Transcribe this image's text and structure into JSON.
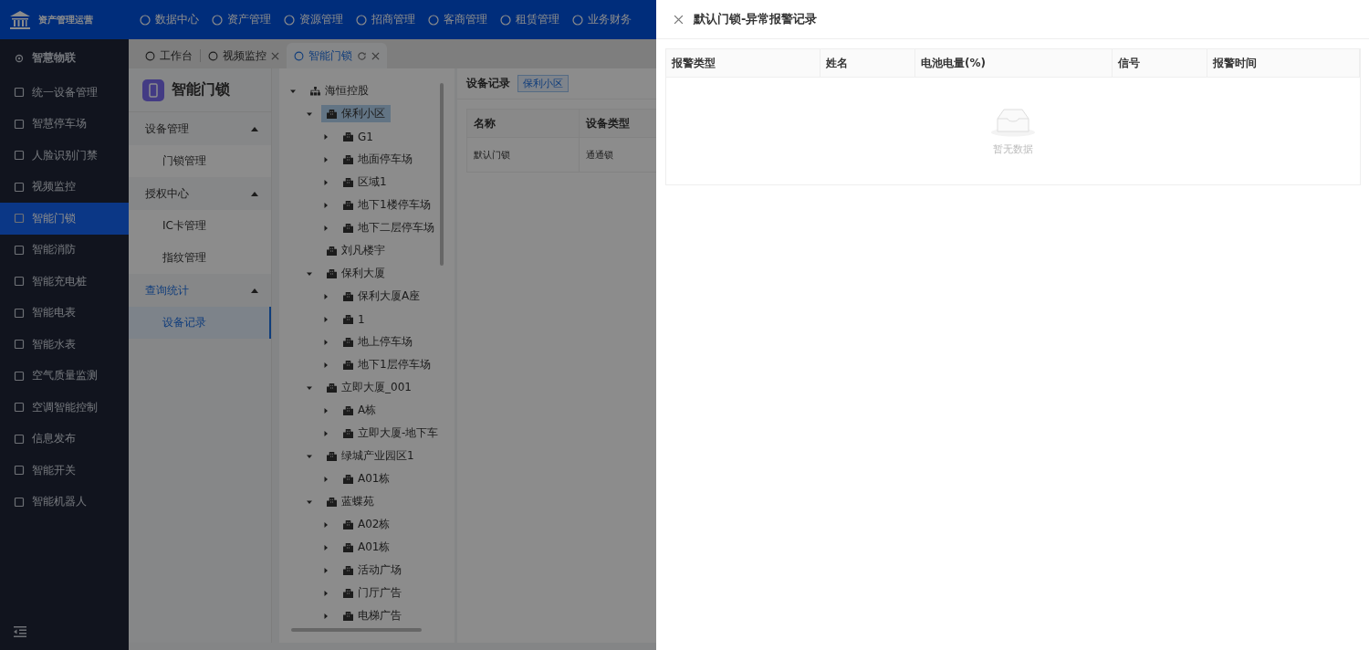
{
  "header": {
    "app_title": "资产管理运营",
    "nav": [
      {
        "label": "数据中心"
      },
      {
        "label": "资产管理"
      },
      {
        "label": "资源管理"
      },
      {
        "label": "招商管理"
      },
      {
        "label": "客商管理"
      },
      {
        "label": "租赁管理"
      },
      {
        "label": "业务财务"
      }
    ]
  },
  "sidebar": {
    "section": "智慧物联",
    "items": [
      {
        "label": "统一设备管理",
        "selected": false
      },
      {
        "label": "智慧停车场",
        "selected": false
      },
      {
        "label": "人脸识别门禁",
        "selected": false
      },
      {
        "label": "视频监控",
        "selected": false
      },
      {
        "label": "智能门锁",
        "selected": true
      },
      {
        "label": "智能消防",
        "selected": false
      },
      {
        "label": "智能充电桩",
        "selected": false
      },
      {
        "label": "智能电表",
        "selected": false
      },
      {
        "label": "智能水表",
        "selected": false
      },
      {
        "label": "空气质量监测",
        "selected": false
      },
      {
        "label": "空调智能控制",
        "selected": false
      },
      {
        "label": "信息发布",
        "selected": false
      },
      {
        "label": "智能开关",
        "selected": false
      },
      {
        "label": "智能机器人",
        "selected": false
      }
    ]
  },
  "tabs": [
    {
      "label": "工作台",
      "selected": false,
      "closable": false
    },
    {
      "label": "视频监控",
      "selected": false,
      "closable": true
    },
    {
      "label": "智能门锁",
      "selected": true,
      "closable": true
    }
  ],
  "module": {
    "title": "智能门锁",
    "groups": [
      {
        "title": "设备管理",
        "expanded": true,
        "active": false,
        "items": [
          {
            "label": "门锁管理",
            "selected": false
          }
        ]
      },
      {
        "title": "授权中心",
        "expanded": true,
        "active": false,
        "items": [
          {
            "label": "IC卡管理",
            "selected": false
          },
          {
            "label": "指纹管理",
            "selected": false
          }
        ]
      },
      {
        "title": "查询统计",
        "expanded": true,
        "active": true,
        "items": [
          {
            "label": "设备记录",
            "selected": true
          }
        ]
      }
    ]
  },
  "tree": [
    {
      "label": "海恒控股",
      "kind": "org",
      "expandable": true,
      "expanded": true,
      "selected": false,
      "children": [
        {
          "label": "保利小区",
          "kind": "building",
          "expandable": true,
          "expanded": true,
          "selected": true,
          "children": [
            {
              "label": "G1",
              "kind": "building",
              "expandable": true,
              "expanded": false,
              "selected": false
            },
            {
              "label": "地面停车场",
              "kind": "building",
              "expandable": true,
              "expanded": false,
              "selected": false
            },
            {
              "label": "区域1",
              "kind": "building",
              "expandable": true,
              "expanded": false,
              "selected": false
            },
            {
              "label": "地下1楼停车场",
              "kind": "building",
              "expandable": true,
              "expanded": false,
              "selected": false
            },
            {
              "label": "地下二层停车场",
              "kind": "building",
              "expandable": true,
              "expanded": false,
              "selected": false
            }
          ]
        },
        {
          "label": "刘凡楼宇",
          "kind": "building",
          "expandable": false,
          "expanded": false,
          "selected": false
        },
        {
          "label": "保利大厦",
          "kind": "building",
          "expandable": true,
          "expanded": true,
          "selected": false,
          "children": [
            {
              "label": "保利大厦A座",
              "kind": "building",
              "expandable": true,
              "expanded": false,
              "selected": false
            },
            {
              "label": "1",
              "kind": "building",
              "expandable": true,
              "expanded": false,
              "selected": false
            },
            {
              "label": "地上停车场",
              "kind": "building",
              "expandable": true,
              "expanded": false,
              "selected": false
            },
            {
              "label": "地下1层停车场",
              "kind": "building",
              "expandable": true,
              "expanded": false,
              "selected": false
            }
          ]
        },
        {
          "label": "立即大厦_001",
          "kind": "building",
          "expandable": true,
          "expanded": true,
          "selected": false,
          "children": [
            {
              "label": "A栋",
              "kind": "building",
              "expandable": true,
              "expanded": false,
              "selected": false
            },
            {
              "label": "立即大厦-地下车",
              "kind": "building",
              "expandable": true,
              "expanded": false,
              "selected": false
            }
          ]
        },
        {
          "label": "绿城产业园区1",
          "kind": "building",
          "expandable": true,
          "expanded": true,
          "selected": false,
          "children": [
            {
              "label": "A01栋",
              "kind": "building",
              "expandable": true,
              "expanded": false,
              "selected": false
            }
          ]
        },
        {
          "label": "蓝蝶苑",
          "kind": "building",
          "expandable": true,
          "expanded": true,
          "selected": false,
          "children": [
            {
              "label": "A02栋",
              "kind": "building",
              "expandable": true,
              "expanded": false,
              "selected": false
            },
            {
              "label": "A01栋",
              "kind": "building",
              "expandable": true,
              "expanded": false,
              "selected": false
            },
            {
              "label": "活动广场",
              "kind": "building",
              "expandable": true,
              "expanded": false,
              "selected": false
            },
            {
              "label": "门厅广告",
              "kind": "building",
              "expandable": true,
              "expanded": false,
              "selected": false
            },
            {
              "label": "电梯广告",
              "kind": "building",
              "expandable": true,
              "expanded": false,
              "selected": false
            }
          ]
        }
      ]
    }
  ],
  "records": {
    "title": "设备记录",
    "tag": "保利小区",
    "columns": [
      "名称",
      "设备类型"
    ],
    "rows": [
      [
        "默认门锁",
        "通通锁"
      ]
    ]
  },
  "drawer": {
    "title": "默认门锁-异常报警记录",
    "columns": [
      "报警类型",
      "姓名",
      "电池电量(%)",
      "信号",
      "报警时间"
    ],
    "empty_text": "暂无数据"
  }
}
